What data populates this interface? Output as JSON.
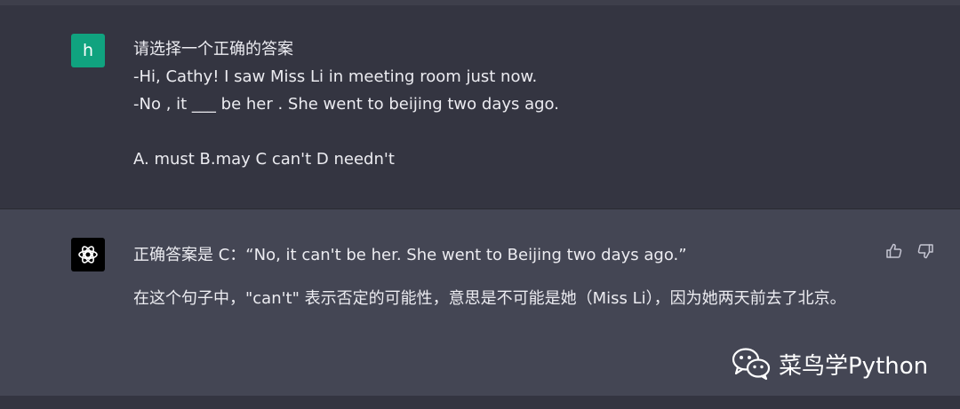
{
  "user_message": {
    "avatar_letter": "h",
    "avatar_color": "#10a37f",
    "lines": [
      "请选择一个正确的答案",
      "-Hi, Cathy! I saw Miss Li in meeting room just now.",
      "-No , it ___ be her . She went to beijing two days ago.",
      "A. must B.may C can't D needn't"
    ]
  },
  "assistant_message": {
    "avatar_icon": "openai-logo-icon",
    "paragraph1": "正确答案是 C：“No, it can't be her. She went to Beijing two days ago.”",
    "paragraph2": "在这个句子中，\"can't\" 表示否定的可能性，意思是不可能是她（Miss Li），因为她两天前去了北京。",
    "feedback_icons": [
      "thumbs-up-icon",
      "thumbs-down-icon"
    ]
  },
  "watermark": {
    "icon": "wechat-icon",
    "text": "菜鸟学Python"
  },
  "colors": {
    "background": "#343541",
    "assistant_background": "#444654",
    "text": "#ececf1"
  }
}
